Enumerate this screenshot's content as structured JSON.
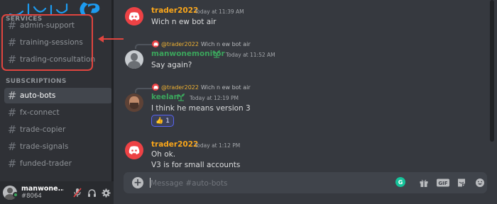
{
  "sidebar": {
    "section_top": "SERVICES",
    "channels_top": [
      {
        "label": "admin-support"
      },
      {
        "label": "training-sessions"
      },
      {
        "label": "trading-consultation"
      }
    ],
    "section_subscriptions": "SUBSCRIPTIONS",
    "channels_sub": [
      {
        "label": "auto-bots",
        "active": true
      },
      {
        "label": "fx-connect"
      },
      {
        "label": "trade-copier"
      },
      {
        "label": "trade-signals"
      },
      {
        "label": "funded-trader"
      }
    ],
    "hash_symbol": "#"
  },
  "user_panel": {
    "name": "manwone...",
    "tag": "#8064"
  },
  "messages": [
    {
      "author": "trader2022",
      "author_color": "#faa61a",
      "time": "Today at 11:39 AM",
      "text": "Wich n ew bot air"
    },
    {
      "reply_mention": "@trader2022",
      "reply_text": "Wich n ew bot air",
      "author": "manwonemonitor",
      "author_color": "#3ba55c",
      "time": "Today at 11:52 AM",
      "text": "Say again?"
    },
    {
      "reply_mention": "@trader2022",
      "reply_text": "Wich n ew bot air",
      "author": "keelan",
      "author_color": "#3ba55c",
      "time": "Today at 12:19 PM",
      "text": "I think he means version 3",
      "reaction_emoji": "👍",
      "reaction_count": "1"
    },
    {
      "author": "trader2022",
      "author_color": "#faa61a",
      "time": "Today at 1:12 PM",
      "text": "Oh ok.",
      "text2": "V3 is for small accounts"
    }
  ],
  "composer": {
    "placeholder": "Message #auto-bots",
    "grammarly_letter": "G",
    "gif_label": "GIF"
  },
  "colors": {
    "accent_red": "#e0453f",
    "discord_red": "#ed4245",
    "gold_name": "#faa61a",
    "green_name": "#3ba55c"
  },
  "icons": [
    "hash-icon",
    "arrow-left-icon",
    "brand-logo-icon",
    "discord-avatar-icon",
    "sprout-icon",
    "mic-muted-icon",
    "headphones-icon",
    "gear-icon",
    "plus-icon",
    "gift-icon",
    "gif-icon",
    "sticker-icon",
    "emoji-icon"
  ]
}
